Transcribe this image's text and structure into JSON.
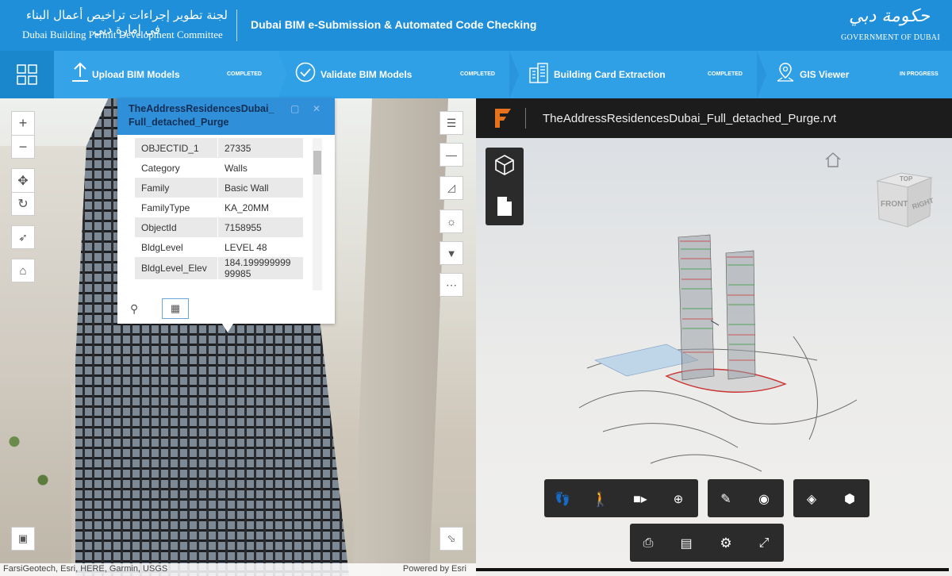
{
  "header": {
    "committee_arabic": "لجنة تطوير إجراءات تراخيص أعمال البناء في إمارة دبي",
    "committee_english": "Dubai Building Permit Development Committee",
    "app_title": "Dubai BIM e-Submission & Automated Code Checking",
    "gov_arabic": "حكومة دبي",
    "gov_english": "GOVERNMENT OF DUBAI"
  },
  "steps": [
    {
      "label": "Upload BIM Models",
      "status": "COMPLETED",
      "icon": "upload-icon"
    },
    {
      "label": "Validate BIM Models",
      "status": "COMPLETED",
      "icon": "check-circle-icon"
    },
    {
      "label": "Building Card Extraction",
      "status": "COMPLETED",
      "icon": "building-icon"
    },
    {
      "label": "GIS Viewer",
      "status": "IN PROGRESS",
      "icon": "map-pin-icon"
    }
  ],
  "popup": {
    "title": "TheAddressResidencesDubai_ Full_detached_Purge",
    "rows": [
      {
        "key": "OBJECTID_1",
        "value": "27335"
      },
      {
        "key": "Category",
        "value": "Walls"
      },
      {
        "key": "Family",
        "value": "Basic Wall"
      },
      {
        "key": "FamilyType",
        "value": "KA_20MM"
      },
      {
        "key": "ObjectId",
        "value": "7158955"
      },
      {
        "key": "BldgLevel",
        "value": "LEVEL 48"
      },
      {
        "key": "BldgLevel_Elev",
        "value": "184.199999999 99985"
      }
    ]
  },
  "map": {
    "attribution": "FarsiGeotech, Esri, HERE, Garmin, USGS",
    "powered_by": "Powered by Esri"
  },
  "viewer": {
    "file_name": "TheAddressResidencesDubai_Full_detached_Purge.rvt",
    "viewcube_faces": {
      "top": "TOP",
      "front": "FRONT",
      "right": "RIGHT"
    }
  },
  "colors": {
    "header_bg": "#1e8fd8",
    "steps_bg": "#2f9fe6",
    "popup_header": "#2f8fd9",
    "viewer_toolbar": "#2b2b2b"
  }
}
